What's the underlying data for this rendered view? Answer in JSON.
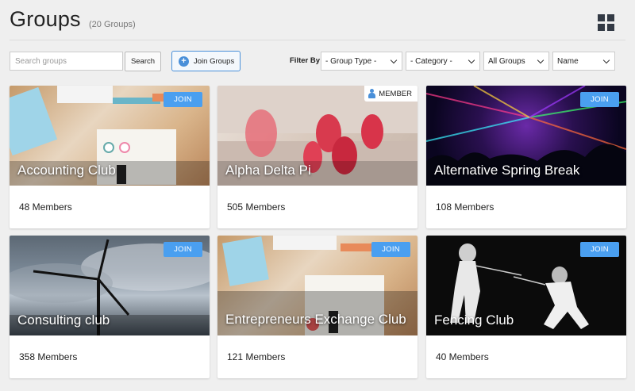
{
  "header": {
    "title": "Groups",
    "count": "(20 Groups)"
  },
  "toolbar": {
    "search_placeholder": "Search groups",
    "search_label": "Search",
    "join_groups_label": "Join Groups",
    "filter_label": "Filter By",
    "filters": [
      {
        "value": "- Group Type -"
      },
      {
        "value": "- Category -"
      },
      {
        "value": "All Groups"
      },
      {
        "value": "Name"
      }
    ]
  },
  "groups": [
    {
      "name": "Accounting Club",
      "members": "48 Members",
      "action": "JOIN"
    },
    {
      "name": "Alpha Delta Pi",
      "members": "505 Members",
      "badge": "MEMBER"
    },
    {
      "name": "Alternative Spring Break",
      "members": "108 Members",
      "action": "JOIN"
    },
    {
      "name": "Consulting club",
      "members": "358 Members",
      "action": "JOIN"
    },
    {
      "name": "Entrepreneurs Exchange Club",
      "members": "121 Members",
      "action": "JOIN"
    },
    {
      "name": "Fencing Club",
      "members": "40 Members",
      "action": "JOIN"
    }
  ],
  "colors": {
    "accent": "#4a90d9",
    "join_button": "#4a9ff0",
    "background": "#efefef"
  },
  "icons": [
    "grid-view-icon",
    "plus-icon",
    "chevron-down-icon",
    "person-icon"
  ]
}
